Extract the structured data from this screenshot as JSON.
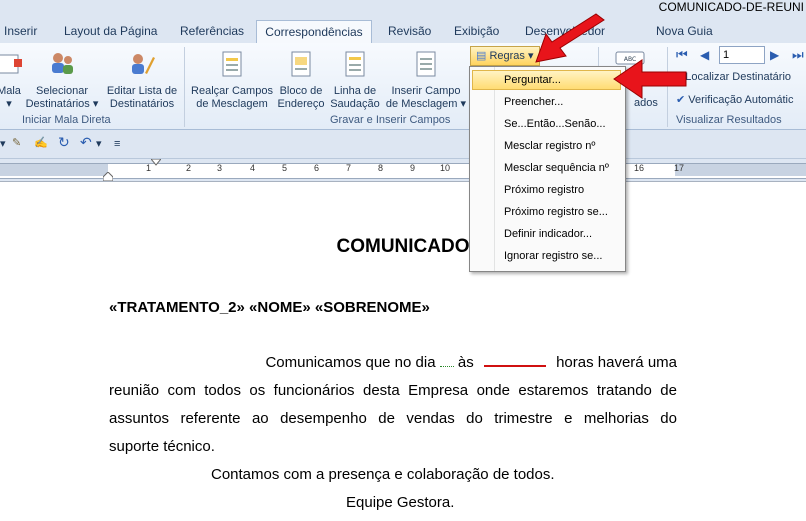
{
  "window": {
    "title": "COMUNICADO-DE-REUNI"
  },
  "tabs": [
    "Inserir",
    "Layout da Página",
    "Referências",
    "Correspondências",
    "Revisão",
    "Exibição",
    "Desenvolvedor",
    "Nova Guia"
  ],
  "active_tab": "Correspondências",
  "ribbon": {
    "mala_label_1": "Mala",
    "selecionar_1": "Selecionar",
    "selecionar_2": "Destinatários",
    "editar_1": "Editar Lista de",
    "editar_2": "Destinatários",
    "group_iniciar": "Iniciar Mala Direta",
    "realcar_1": "Realçar Campos",
    "realcar_2": "de Mesclagem",
    "bloco_1": "Bloco de",
    "bloco_2": "Endereço",
    "linha_1": "Linha de",
    "linha_2": "Saudação",
    "inserir_1": "Inserir Campo",
    "inserir_2": "de Mesclagem",
    "group_gravar": "Gravar e Inserir Campos",
    "regras": "Regras",
    "preview_partial": "ados",
    "record_number": "1",
    "localizar": "Localizar Destinatário",
    "verificacao": "Verificação Automátic",
    "group_visualizar": "Visualizar Resultados"
  },
  "rules_menu": [
    "Perguntar...",
    "Preencher...",
    "Se...Então...Senão...",
    "Mesclar registro nº",
    "Mesclar sequência nº",
    "Próximo registro",
    "Próximo registro se...",
    "Definir indicador...",
    "Ignorar registro se..."
  ],
  "ruler_numbers": [
    "1",
    "2",
    "3",
    "4",
    "5",
    "6",
    "7",
    "8",
    "9",
    "10",
    "11",
    "12",
    "13",
    "14",
    "15",
    "16",
    "17"
  ],
  "document": {
    "title": "COMUNICADO",
    "merge_fields": "«TRATAMENTO_2» «NOME» «SOBRENOME»",
    "p1_line1_a": "Comunicamos que no dia",
    "p1_line1_b": "às",
    "p1_line1_c": "horas haverá uma",
    "p1_line2": "reunião com todos os funcionários desta Empresa onde estaremos tratando de",
    "p1_line3": "assuntos referente ao desempenho de vendas do trimestre e melhorias do",
    "p1_line4": "suporte técnico.",
    "p2": "Contamos com a presença e colaboração de todos.",
    "p3": "Equipe Gestora."
  },
  "colors": {
    "accent": "#ffd35e",
    "arrow": "#e8141b",
    "blank_line": "#d01010"
  }
}
